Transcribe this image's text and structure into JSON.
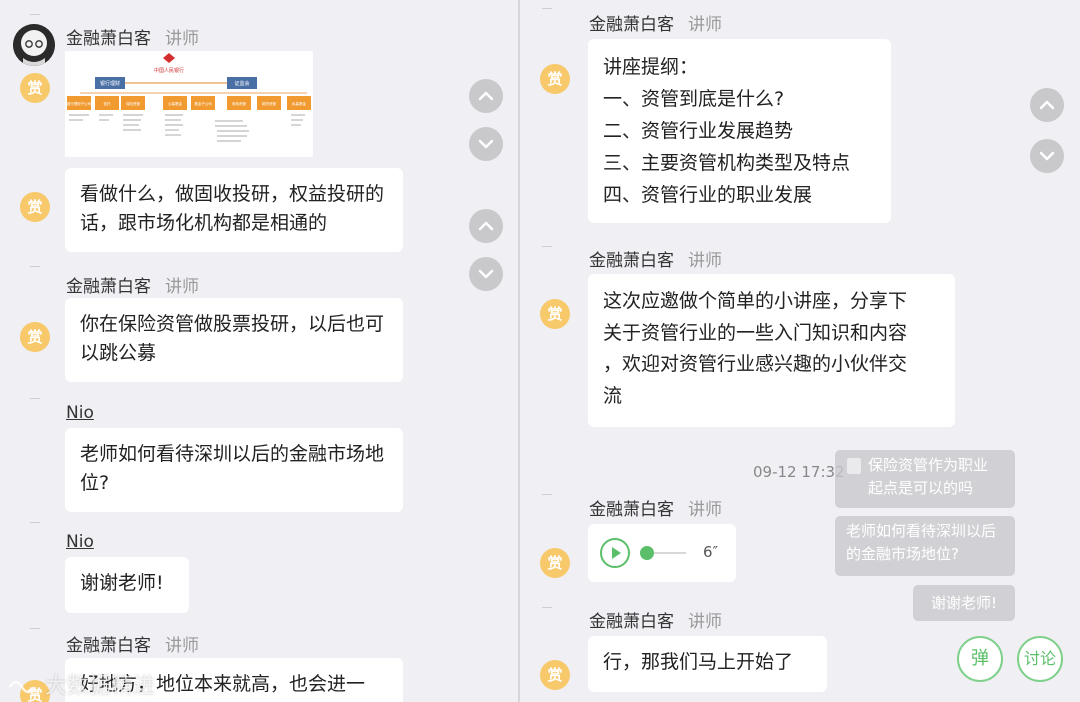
{
  "left": {
    "messages": [
      {
        "sender": "金融萧白客",
        "role": "讲师",
        "badge": "赏"
      },
      {
        "text": "看做什么，做固收投研，权益投研的\n话，跟市场化机构都是相通的",
        "badge": "赏"
      },
      {
        "sender": "金融萧白客",
        "role": "讲师",
        "text": "你在保险资管做股票投研，以后也可\n以跳公募",
        "badge": "赏"
      },
      {
        "sender": "Nio",
        "text": "老师如何看待深圳以后的金融市场地\n位?"
      },
      {
        "sender": "Nio",
        "text": "谢谢老师!"
      },
      {
        "sender": "金融萧白客",
        "role": "讲师",
        "text": "好地方，地位本来就高，也会进一",
        "badge": "赏"
      }
    ],
    "org_chart": {
      "title": "中国人民银行",
      "top_nodes": [
        "银行理财",
        "证监会"
      ],
      "nodes": [
        "银行理财子公司",
        "信托",
        "保险资管",
        "公募基金",
        "基金子公司",
        "券商资管",
        "期货资管",
        "私募基金"
      ]
    }
  },
  "right": {
    "messages": [
      {
        "sender": "金融萧白客",
        "role": "讲师",
        "text": "讲座提纲：\n一、资管到底是什么?\n二、资管行业发展趋势\n三、主要资管机构类型及特点\n四、资管行业的职业发展",
        "badge": "赏"
      },
      {
        "sender": "金融萧白客",
        "role": "讲师",
        "text": "这次应邀做个简单的小讲座，分享下\n关于资管行业的一些入门知识和内容\n，欢迎对资管行业感兴趣的小伙伴交\n流",
        "badge": "赏"
      },
      {
        "sender": "金融萧白客",
        "role": "讲师",
        "audio_duration": "6″",
        "badge": "赏"
      },
      {
        "sender": "金融萧白客",
        "role": "讲师",
        "text": "行，那我们马上开始了",
        "badge": "赏"
      }
    ],
    "timestamp": "09-12 17:32",
    "overlays": [
      "保险资管作为职业\n起点是可以的吗",
      "老师如何看待深圳以后\n的金融市场地位?",
      "谢谢老师!"
    ],
    "actions": [
      "弹",
      "讨论"
    ]
  },
  "watermark": "大数据精进",
  "colors": {
    "badge": "#f7c96b",
    "accent_green": "#5bbf6a",
    "background": "#efeff4"
  }
}
